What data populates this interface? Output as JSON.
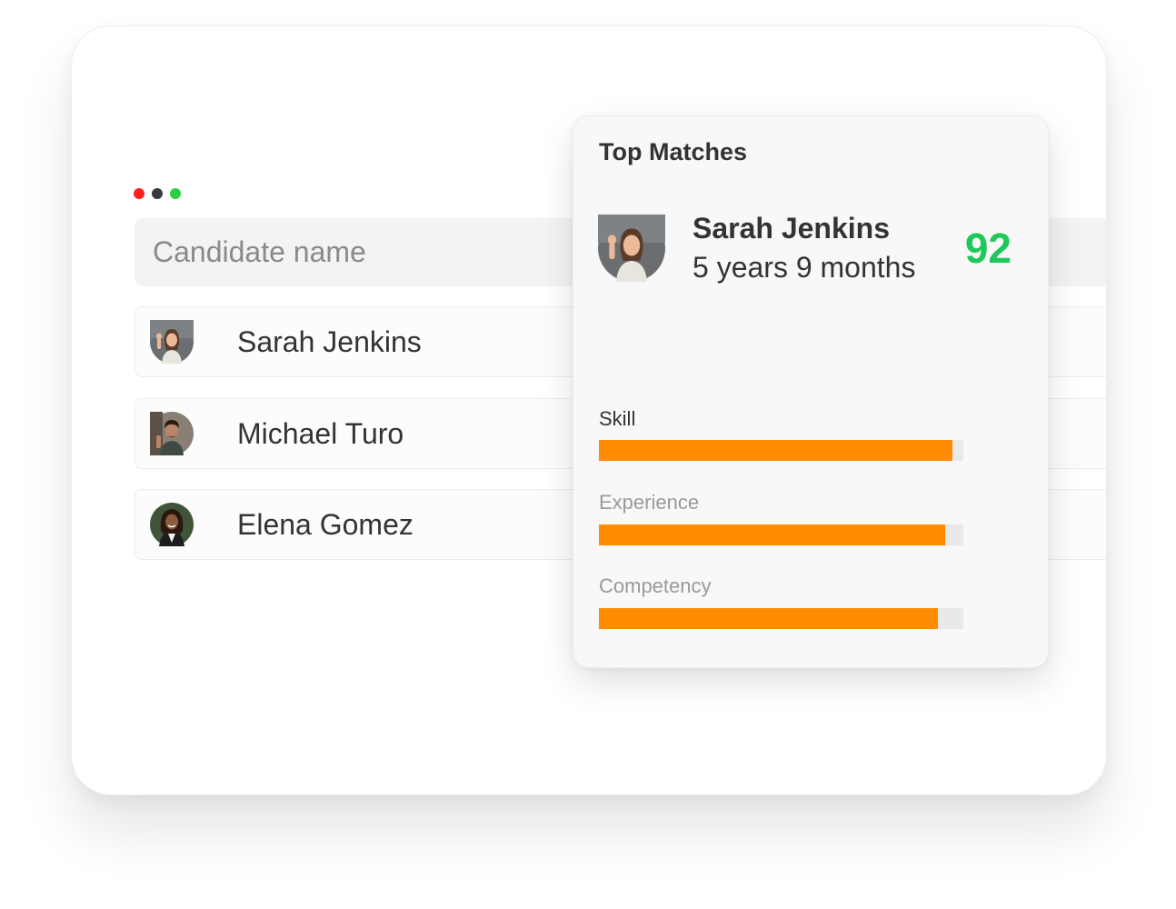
{
  "window": {
    "traffic_lights": [
      "#ff1f1f",
      "#3a3a3a",
      "#28d042"
    ]
  },
  "search": {
    "placeholder": "Candidate name"
  },
  "candidates": [
    {
      "name": "Sarah Jenkins",
      "avatar": "avatar-sarah"
    },
    {
      "name": "Michael Turo",
      "avatar": "avatar-michael"
    },
    {
      "name": "Elena Gomez",
      "avatar": "avatar-elena"
    }
  ],
  "top_matches": {
    "title": "Top Matches",
    "name": "Sarah Jenkins",
    "experience": "5 years 9 months",
    "score": "92",
    "score_color": "#1ec95a",
    "metrics": [
      {
        "label": "Skill",
        "value": 0.97
      },
      {
        "label": "Experience",
        "value": 0.95
      },
      {
        "label": "Competency",
        "value": 0.93
      }
    ],
    "bar_color": "#ff8c00"
  }
}
